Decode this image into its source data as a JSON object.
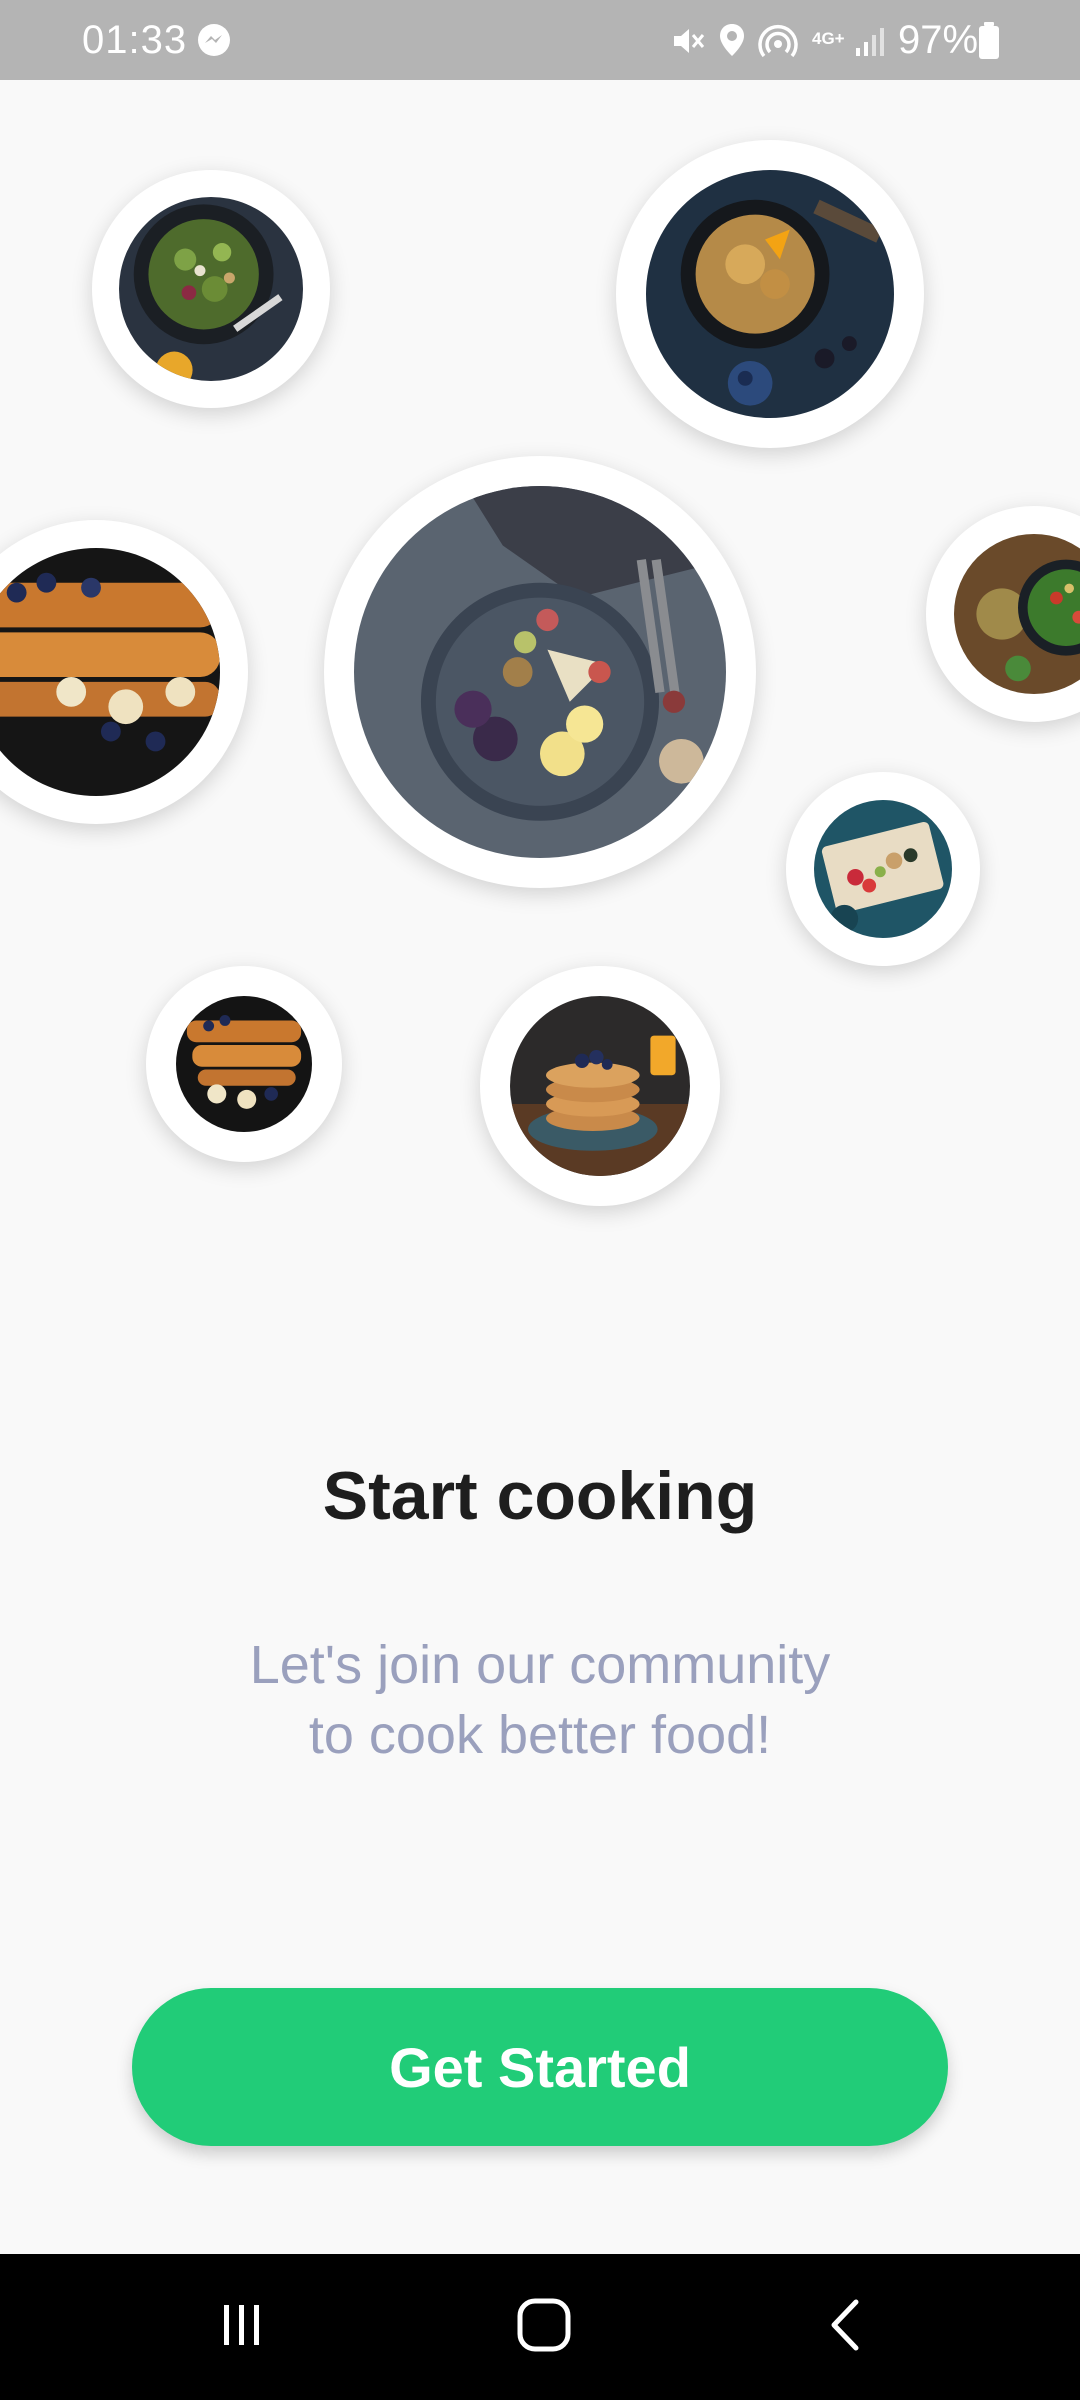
{
  "status_bar": {
    "time": "01:33",
    "battery": "97%",
    "network": "4G+",
    "icons": [
      "messenger-icon",
      "mute-icon",
      "location-icon",
      "hotspot-icon",
      "network-4g-icon",
      "signal-icon",
      "battery-icon"
    ]
  },
  "onboarding": {
    "title": "Start cooking",
    "subtitle_line1": "Let's join our community",
    "subtitle_line2": "to cook better food!",
    "cta_label": "Get Started"
  },
  "nav_bar": {
    "icons": [
      "recent-apps-icon",
      "home-icon",
      "back-icon"
    ]
  },
  "colors": {
    "accent": "#21cc78",
    "title": "#1e1e1e",
    "subtitle": "#9aa0bd",
    "background": "#f9f9f9",
    "status_bar": "#b4b4b4"
  }
}
